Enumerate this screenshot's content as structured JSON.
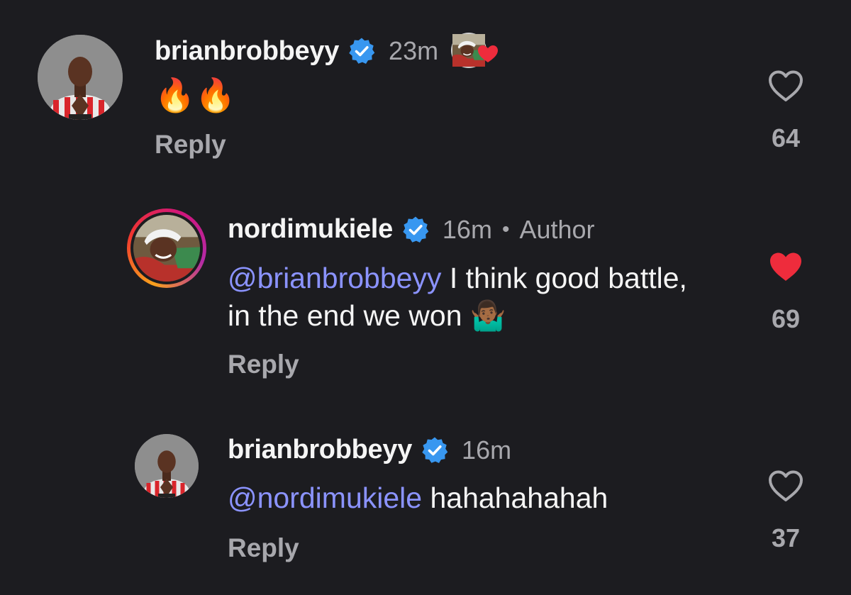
{
  "comments": [
    {
      "username": "brianbrobbeyy",
      "verified": true,
      "time": "23m",
      "author_liked": true,
      "text": "🔥🔥",
      "mention": "",
      "reply_label": "Reply",
      "like_count": "64",
      "liked": false
    },
    {
      "username": "nordimukiele",
      "verified": true,
      "time": "16m",
      "author_tag": "Author",
      "mention": "@brianbrobbeyy",
      "text": " I think good battle, in the end we won 🤷🏾‍♂️",
      "reply_label": "Reply",
      "like_count": "69",
      "liked": true
    },
    {
      "username": "brianbrobbeyy",
      "verified": true,
      "time": "16m",
      "mention": "@nordimukiele",
      "text": " hahahahahah",
      "reply_label": "Reply",
      "like_count": "37",
      "liked": false
    }
  ],
  "colors": {
    "background": "#1c1c20",
    "mention": "#8b93ff",
    "verified": "#3897f0",
    "liked_heart": "#ee2c3c",
    "muted": "#a8a8ad"
  }
}
